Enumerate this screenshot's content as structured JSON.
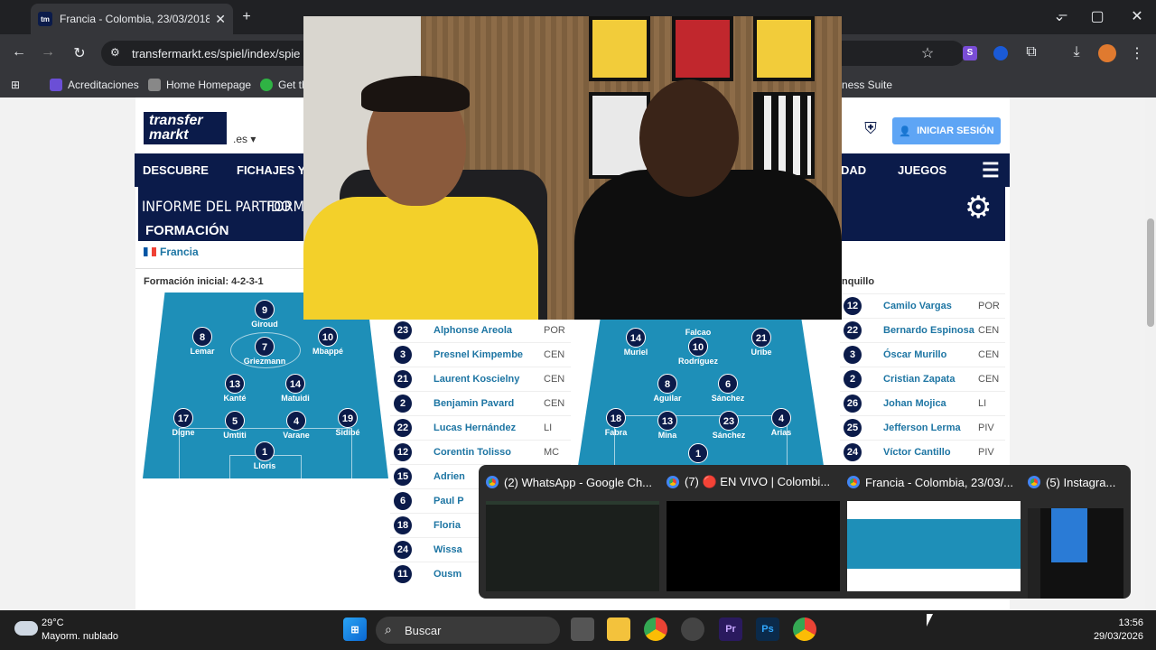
{
  "browser": {
    "tab_title": "Francia - Colombia, 23/03/2018",
    "tab_favicon": "tm",
    "url": "transfermarkt.es/spiel/index/spie",
    "bookmarks": [
      "Acreditaciones",
      "Home Homepage",
      "Get th",
      "ness Suite"
    ]
  },
  "site": {
    "logo_line1": "transfer",
    "logo_line2": "markt",
    "domain_suffix": ".es",
    "login_label": "INICIAR SESIÓN",
    "nav": [
      "DESCUBRE",
      "FICHAJES Y",
      "DAD",
      "JUEGOS"
    ],
    "subnav_tabs": [
      "INFORME DEL PARTIDO",
      "FORMA"
    ],
    "section_title": "FORMACIÓN",
    "home_team": "Francia",
    "formation_label": "Formación inicial: 4-2-3-1",
    "away_header": "nquillo"
  },
  "home_field": [
    {
      "n": "9",
      "name": "Giroud"
    },
    {
      "n": "8",
      "name": "Lemar"
    },
    {
      "n": "7",
      "name": "Griezmann"
    },
    {
      "n": "10",
      "name": "Mbappé"
    },
    {
      "n": "13",
      "name": "Kanté"
    },
    {
      "n": "14",
      "name": "Matuidi"
    },
    {
      "n": "17",
      "name": "Digne"
    },
    {
      "n": "5",
      "name": "Umtiti"
    },
    {
      "n": "4",
      "name": "Varane"
    },
    {
      "n": "19",
      "name": "Sidibé"
    },
    {
      "n": "1",
      "name": "Lloris"
    }
  ],
  "away_field": [
    {
      "n": "",
      "name": "Falcao"
    },
    {
      "n": "14",
      "name": "Muriel"
    },
    {
      "n": "10",
      "name": "Rodríguez"
    },
    {
      "n": "21",
      "name": "Uribe"
    },
    {
      "n": "8",
      "name": "Aguilar"
    },
    {
      "n": "6",
      "name": "Sánchez"
    },
    {
      "n": "18",
      "name": "Fabra"
    },
    {
      "n": "13",
      "name": "Mina"
    },
    {
      "n": "23",
      "name": "Sánchez"
    },
    {
      "n": "4",
      "name": "Arias"
    },
    {
      "n": "1",
      "name": ""
    }
  ],
  "home_bench": [
    {
      "n": "23",
      "name": "Alphonse Areola",
      "pos": "POR"
    },
    {
      "n": "3",
      "name": "Presnel Kimpembe",
      "pos": "CEN"
    },
    {
      "n": "21",
      "name": "Laurent Koscielny",
      "pos": "CEN"
    },
    {
      "n": "2",
      "name": "Benjamin Pavard",
      "pos": "CEN"
    },
    {
      "n": "22",
      "name": "Lucas Hernández",
      "pos": "LI"
    },
    {
      "n": "12",
      "name": "Corentin Tolisso",
      "pos": "MC"
    },
    {
      "n": "15",
      "name": "Adrien",
      "pos": ""
    },
    {
      "n": "6",
      "name": "Paul P",
      "pos": ""
    },
    {
      "n": "18",
      "name": "Floria",
      "pos": ""
    },
    {
      "n": "24",
      "name": "Wissa",
      "pos": ""
    },
    {
      "n": "11",
      "name": "Ousm",
      "pos": ""
    }
  ],
  "away_bench": [
    {
      "n": "12",
      "name": "Camilo Vargas",
      "pos": "POR"
    },
    {
      "n": "22",
      "name": "Bernardo Espinosa",
      "pos": "CEN"
    },
    {
      "n": "3",
      "name": "Óscar Murillo",
      "pos": "CEN"
    },
    {
      "n": "2",
      "name": "Cristian Zapata",
      "pos": "CEN"
    },
    {
      "n": "26",
      "name": "Johan Mojica",
      "pos": "LI"
    },
    {
      "n": "25",
      "name": "Jefferson Lerma",
      "pos": "PIV"
    },
    {
      "n": "24",
      "name": "Víctor Cantillo",
      "pos": "PIV"
    }
  ],
  "previews": [
    {
      "title": "(2) WhatsApp - Google Ch..."
    },
    {
      "title": "(7) 🔴 EN VIVO | Colombi..."
    },
    {
      "title": "Francia - Colombia, 23/03/..."
    },
    {
      "title": "(5) Instagra..."
    }
  ],
  "taskbar": {
    "temp": "29°C",
    "weather": "Mayorm. nublado",
    "search_placeholder": "Buscar",
    "time": "13:56",
    "date": "29/03/2026"
  }
}
